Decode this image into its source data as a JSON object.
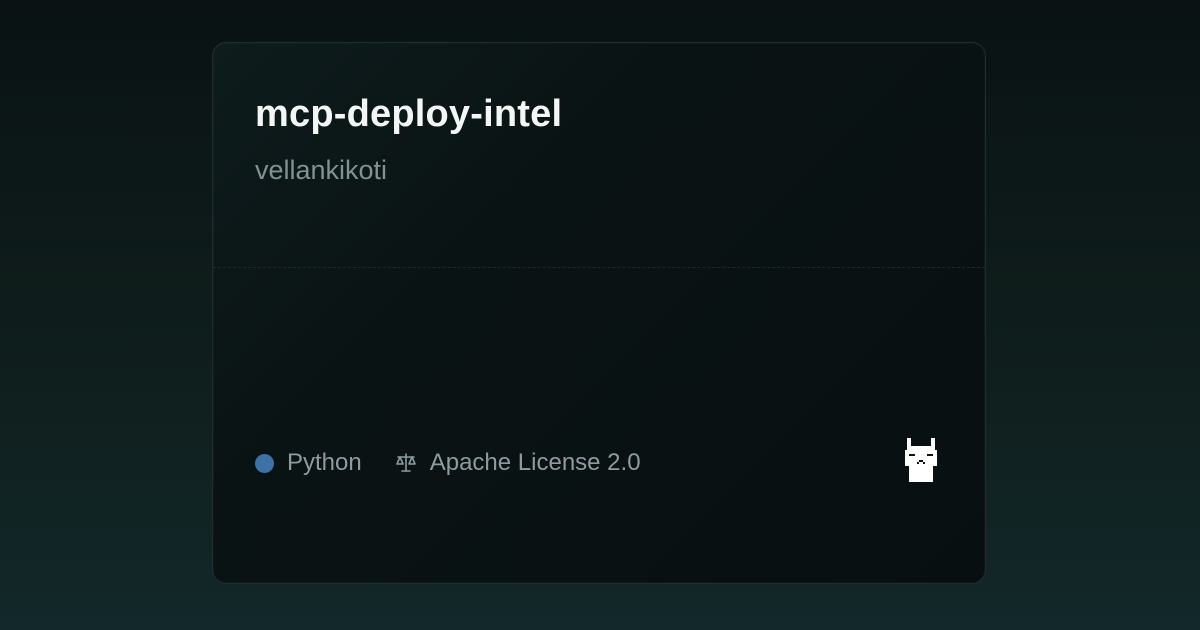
{
  "repo": {
    "name": "mcp-deploy-intel",
    "owner": "vellankikoti"
  },
  "meta": {
    "language": "Python",
    "language_color": "#3b73a6",
    "license": "Apache License 2.0",
    "license_icon": "scale-icon"
  },
  "brand": {
    "logo_icon": "llama-icon"
  },
  "colors": {
    "title": "#f3f6f5",
    "owner": "#7f9390",
    "meta_text": "#8e9ba0"
  }
}
